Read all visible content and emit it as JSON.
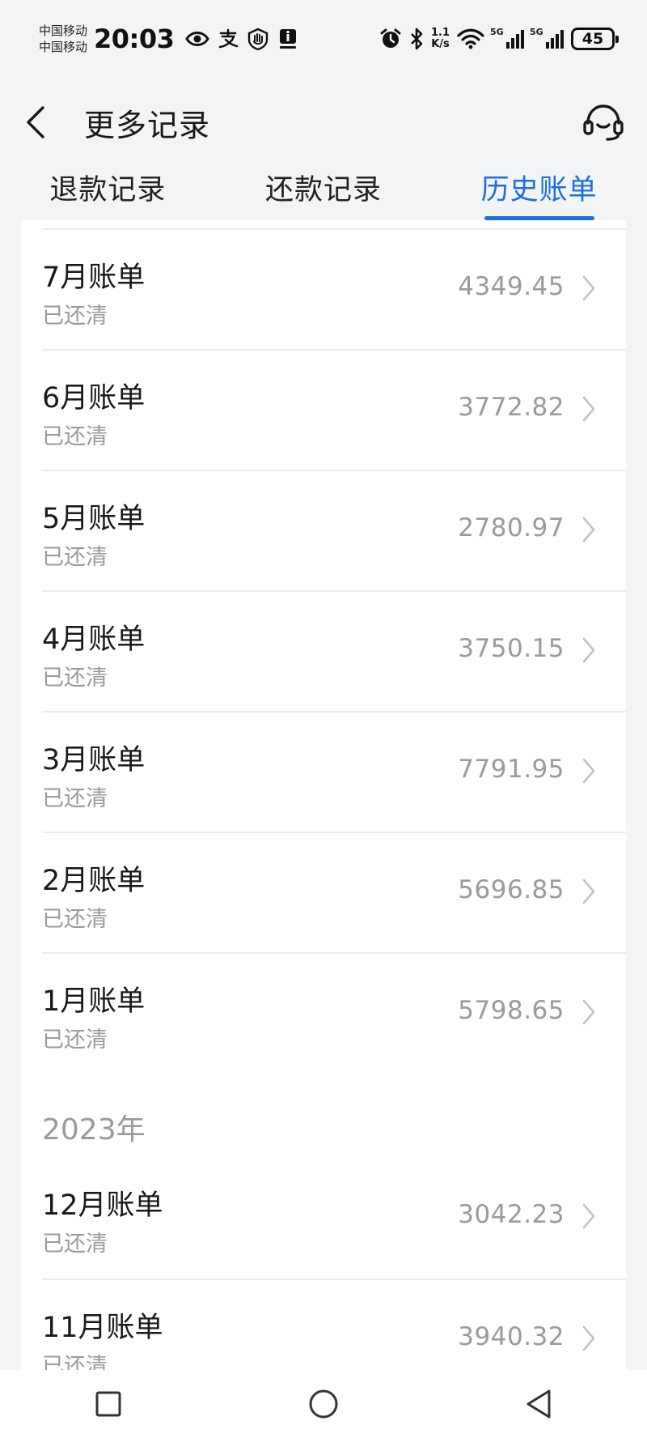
{
  "status_bar": {
    "carrier_1": "中国移动",
    "carrier_2": "中国移动",
    "time": "20:03",
    "net_speed_value": "1.1",
    "net_speed_unit": "K/s",
    "signal_1_label": "5G",
    "signal_2_label": "5G",
    "battery_level": "45"
  },
  "header": {
    "title": "更多记录"
  },
  "tabs": [
    {
      "label": "退款记录",
      "active": false
    },
    {
      "label": "还款记录",
      "active": false
    },
    {
      "label": "历史账单",
      "active": true
    }
  ],
  "sections": [
    {
      "year": "",
      "bills": [
        {
          "title": "7月账单",
          "status": "已还清",
          "amount": "4349.45"
        },
        {
          "title": "6月账单",
          "status": "已还清",
          "amount": "3772.82"
        },
        {
          "title": "5月账单",
          "status": "已还清",
          "amount": "2780.97"
        },
        {
          "title": "4月账单",
          "status": "已还清",
          "amount": "3750.15"
        },
        {
          "title": "3月账单",
          "status": "已还清",
          "amount": "7791.95"
        },
        {
          "title": "2月账单",
          "status": "已还清",
          "amount": "5696.85"
        },
        {
          "title": "1月账单",
          "status": "已还清",
          "amount": "5798.65"
        }
      ]
    },
    {
      "year": "2023年",
      "bills": [
        {
          "title": "12月账单",
          "status": "已还清",
          "amount": "3042.23"
        },
        {
          "title": "11月账单",
          "status": "已还清",
          "amount": "3940.32"
        }
      ]
    }
  ],
  "colors": {
    "accent": "#1d6fe0",
    "background": "#f3f4f6",
    "muted_text": "#9a9a9a"
  },
  "icons": {
    "back": "chevron-left-icon",
    "service": "headset-icon",
    "row_chevron": "chevron-right-icon",
    "nav_recent": "square-icon",
    "nav_home": "circle-icon",
    "nav_back": "triangle-back-icon"
  }
}
